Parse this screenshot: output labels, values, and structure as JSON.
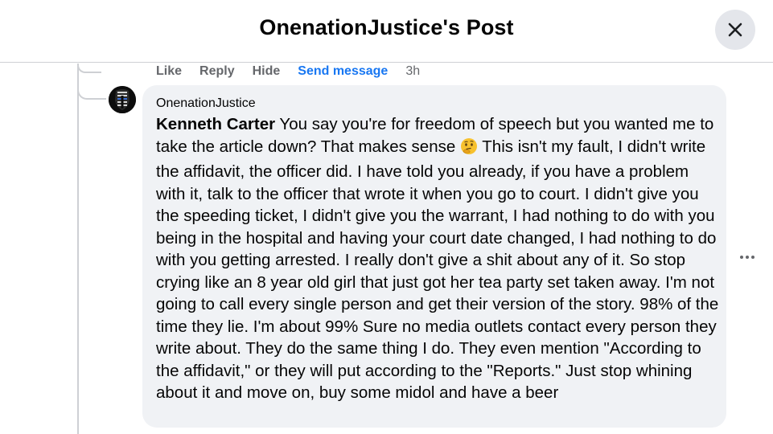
{
  "header": {
    "title": "OnenationJustice's Post",
    "close_icon": "close-icon"
  },
  "previous_comment_actions": {
    "like": "Like",
    "reply": "Reply",
    "hide": "Hide",
    "send_message": "Send message",
    "time": "3h"
  },
  "comment": {
    "author": "OnenationJustice",
    "mention": "Kenneth Carter",
    "text_part1": " You say you're for freedom of speech but you wanted me to take the article down? That makes sense ",
    "emoji": "thinking-face-emoji",
    "text_part2": " This isn't my fault, I didn't write the affidavit, the officer did. I have told you already, if you have a problem with it, talk to the officer that wrote it when you go to court. I didn't give you the speeding ticket, I didn't give you the warrant, I had nothing to do with you being in the hospital and having your court date changed, I had nothing to do with you getting arrested. I really don't give a shit about any of it. So stop crying like an 8 year old girl that just got her tea party set taken away. I'm not going to call every single person and get their version of the story. 98% of the time they lie. I'm about 99% Sure no media outlets contact every person they write about. They do the same thing I do. They even mention \"According to the affidavit,\" or they will put according to the \"Reports.\" Just stop whining about it and move on, buy some midol and have a beer",
    "more_icon": "more-horizontal-icon"
  },
  "colors": {
    "accent": "#1877f2",
    "bubble": "#f0f2f5",
    "secondary_text": "#65676b",
    "close_button_bg": "#e4e6eb"
  }
}
